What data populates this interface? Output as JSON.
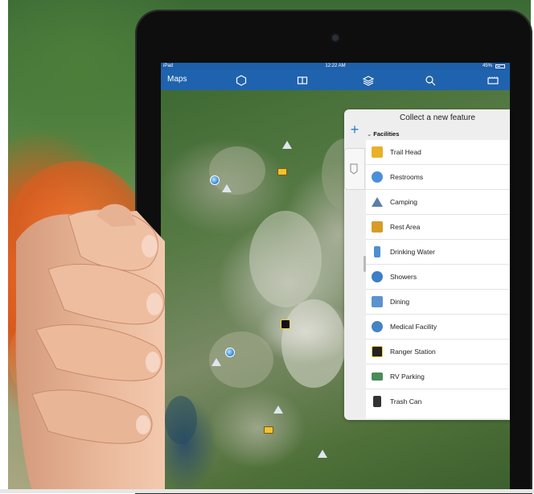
{
  "status_bar": {
    "device": "iPad",
    "time": "12:22 AM",
    "battery": "45%"
  },
  "toolbar": {
    "maps_label": "Maps",
    "icons": [
      "location-icon",
      "book-icon",
      "layers-icon",
      "search-icon",
      "toolbox-icon"
    ]
  },
  "panel": {
    "title": "Collect a new feature",
    "section": "Facilities",
    "items": [
      {
        "label": "Trail Head",
        "icon": "trail-head-icon",
        "color": "#e8b12a"
      },
      {
        "label": "Restrooms",
        "icon": "restrooms-icon",
        "color": "#4a90d9"
      },
      {
        "label": "Camping",
        "icon": "camping-icon",
        "color": "#5a7fa8"
      },
      {
        "label": "Rest Area",
        "icon": "rest-area-icon",
        "color": "#d89b2a"
      },
      {
        "label": "Drinking Water",
        "icon": "drinking-water-icon",
        "color": "#4f8fd0"
      },
      {
        "label": "Showers",
        "icon": "showers-icon",
        "color": "#3c7fc6"
      },
      {
        "label": "Dining",
        "icon": "dining-icon",
        "color": "#5c93cf"
      },
      {
        "label": "Medical Facility",
        "icon": "medical-icon",
        "color": "#4683c4"
      },
      {
        "label": "Ranger Station",
        "icon": "ranger-station-icon",
        "color": "#222222"
      },
      {
        "label": "RV Parking",
        "icon": "rv-parking-icon",
        "color": "#4b8a5a"
      },
      {
        "label": "Trash Can",
        "icon": "trash-can-icon",
        "color": "#333333"
      }
    ]
  },
  "colors": {
    "toolbar": "#1f63ae",
    "accent": "#2e78c7"
  }
}
